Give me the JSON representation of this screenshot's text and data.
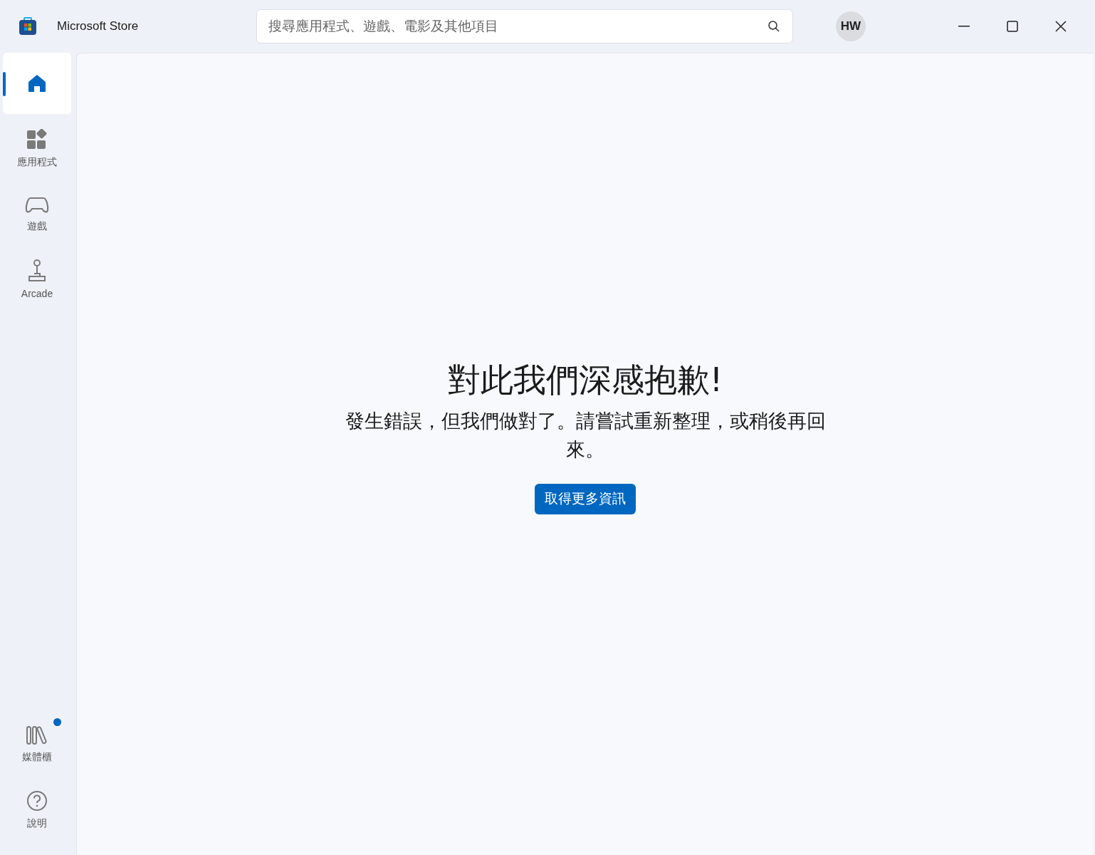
{
  "window": {
    "title": "Microsoft Store"
  },
  "search": {
    "placeholder": "搜尋應用程式、遊戲、電影及其他項目"
  },
  "account": {
    "initials": "HW"
  },
  "nav": {
    "items": [
      {
        "kind": "home",
        "selected": true
      },
      {
        "kind": "apps",
        "label": "應用程式",
        "selected": false
      },
      {
        "kind": "games",
        "label": "遊戲",
        "selected": false
      },
      {
        "kind": "arcade",
        "label": "Arcade",
        "selected": false
      }
    ],
    "bottom_items": [
      {
        "kind": "library",
        "label": "媒體櫃",
        "selected": false,
        "notification": true
      },
      {
        "kind": "help",
        "label": "說明",
        "selected": false,
        "notification": false
      }
    ]
  },
  "error": {
    "title": "對此我們深感抱歉!",
    "message": "發生錯誤，但我們做對了。請嘗試重新整理，或稍後再回來。",
    "button": "取得更多資訊"
  }
}
